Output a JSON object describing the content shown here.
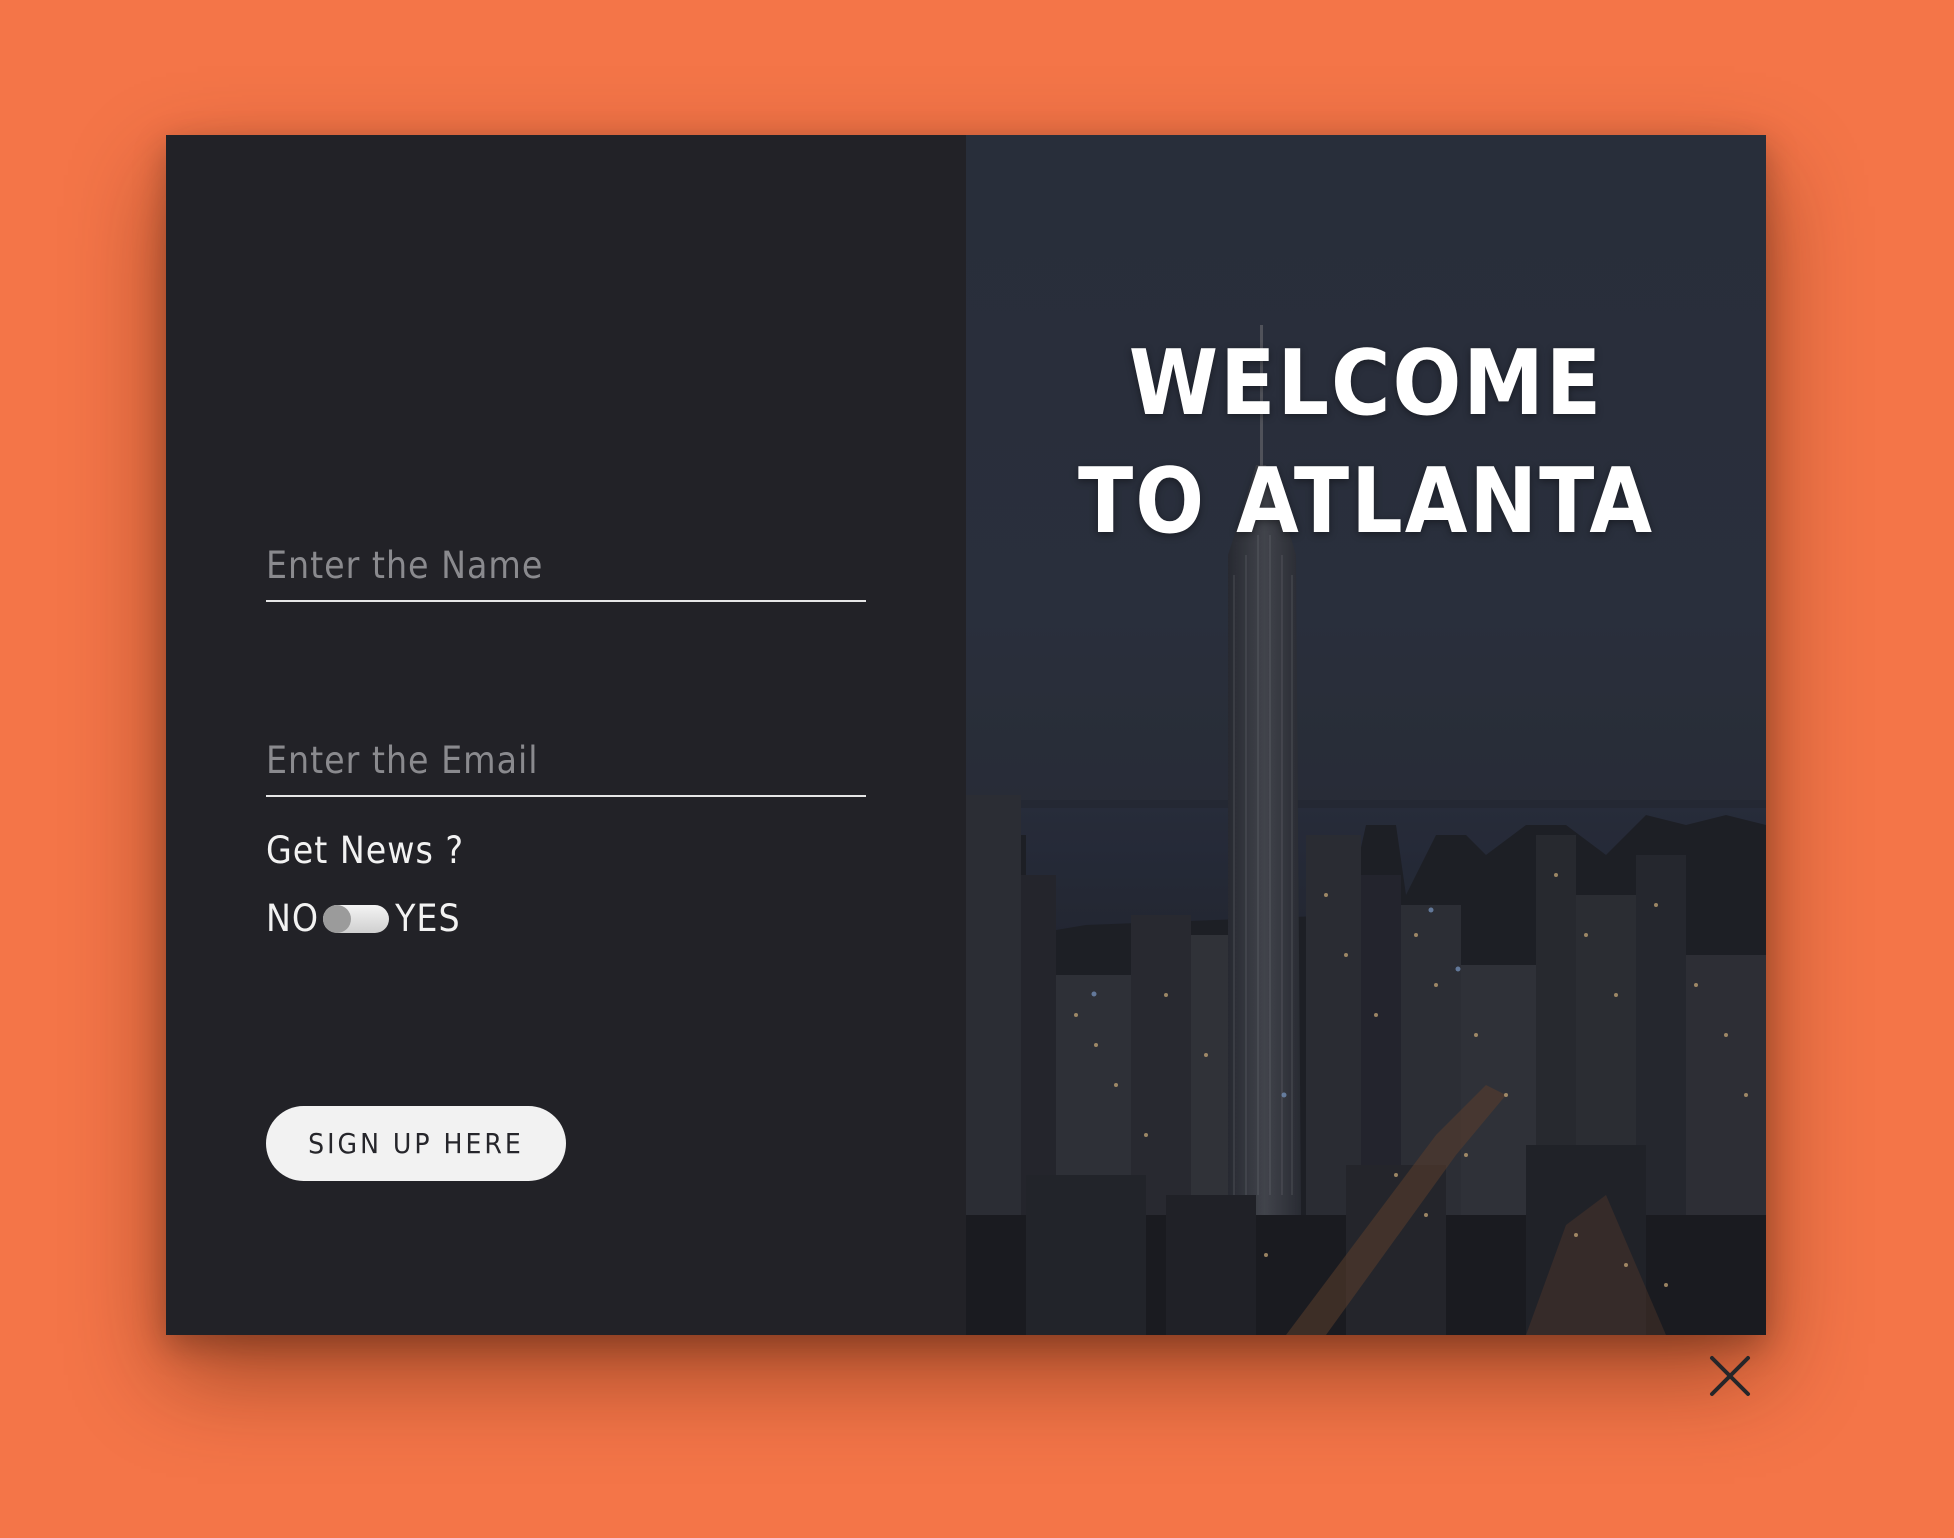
{
  "form": {
    "name_placeholder": "Enter the Name",
    "email_placeholder": "Enter the Email",
    "news_question": "Get News ?",
    "toggle_off_label": "NO",
    "toggle_on_label": "YES",
    "toggle_state": "NO",
    "submit_label": "SIGN UP HERE"
  },
  "hero": {
    "line1": "WELCOME",
    "line2": "TO ATLANTA"
  },
  "icons": {
    "close": "close-icon"
  },
  "colors": {
    "page_background": "#f47548",
    "form_background": "#222227",
    "button_background": "#f2f2f2"
  }
}
